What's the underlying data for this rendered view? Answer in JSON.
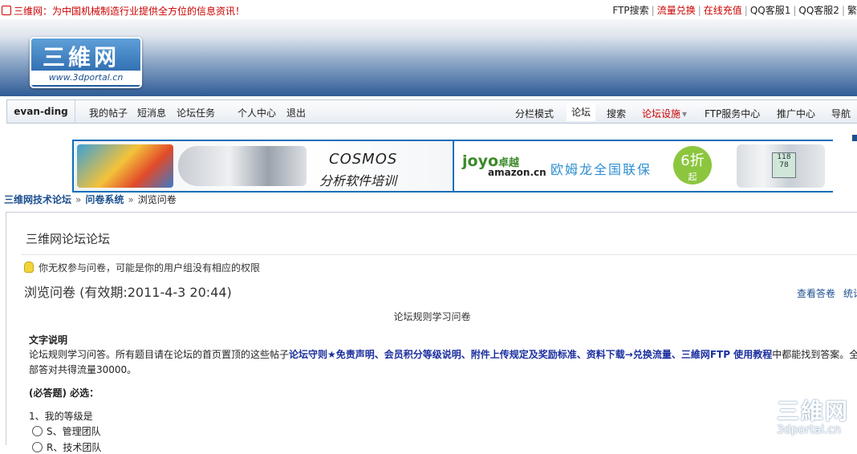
{
  "topbar": {
    "notice": "三维网：为中国机械制造行业提供全方位的信息资讯！",
    "links": [
      "FTP搜索",
      "流量兑换",
      "在线充值",
      "QQ客服1",
      "QQ客服2",
      "繁"
    ]
  },
  "logo": {
    "cn": "三維网",
    "url": "www.3dportal.cn"
  },
  "nav": {
    "username": "evan-ding",
    "left_links": [
      "我的帖子",
      "短消息",
      "论坛任务",
      "个人中心",
      "退出"
    ],
    "right_links": [
      "分栏模式",
      "论坛",
      "搜索",
      "论坛设施",
      "FTP服务中心",
      "推广中心",
      "导航"
    ],
    "dropdown_caret": "▾"
  },
  "banner": {
    "ad1_line1": "COSMOS",
    "ad1_line2": "分析软件培训",
    "ad2_brand": "joyo",
    "ad2_brand_cn": "卓越",
    "ad2_amazon": "amazon.cn",
    "ad2_slogan": "欧姆龙全国联保",
    "ad2_discount": "6折",
    "ad2_discount_suffix": "起",
    "ad2_screen": "118 78"
  },
  "breadcrumb": {
    "items": [
      "三维网技术论坛",
      "问卷系统",
      "浏览问卷"
    ],
    "separator": "»"
  },
  "content": {
    "box_title": "三维网论坛论坛",
    "permission_notice": "你无权参与问卷，可能是你的用户组没有相应的权限",
    "survey_title": "浏览问卷 (有效期:2011-4-3 20:44)",
    "right_links": [
      "查看答卷",
      "统计"
    ],
    "survey_name": "论坛规则学习问卷",
    "desc_heading": "文字说明",
    "desc_text_before": "论坛规则学习问答。所有题目请在论坛的首页置顶的这些帖子",
    "desc_links": "论坛守则★免责声明、会员积分等级说明、附件上传规定及奖励标准、资料下载→兑换流量、三維网FTP 使用教程",
    "desc_text_after": "中都能找到答案。全部答对共得流量30000。",
    "required_label": "(必答题) 必选：",
    "question1": "1、我的等级是",
    "options": [
      "S、管理团队",
      "R、技术团队"
    ]
  },
  "watermark": {
    "line1": "三維网",
    "line2": "3dportal.cn"
  }
}
